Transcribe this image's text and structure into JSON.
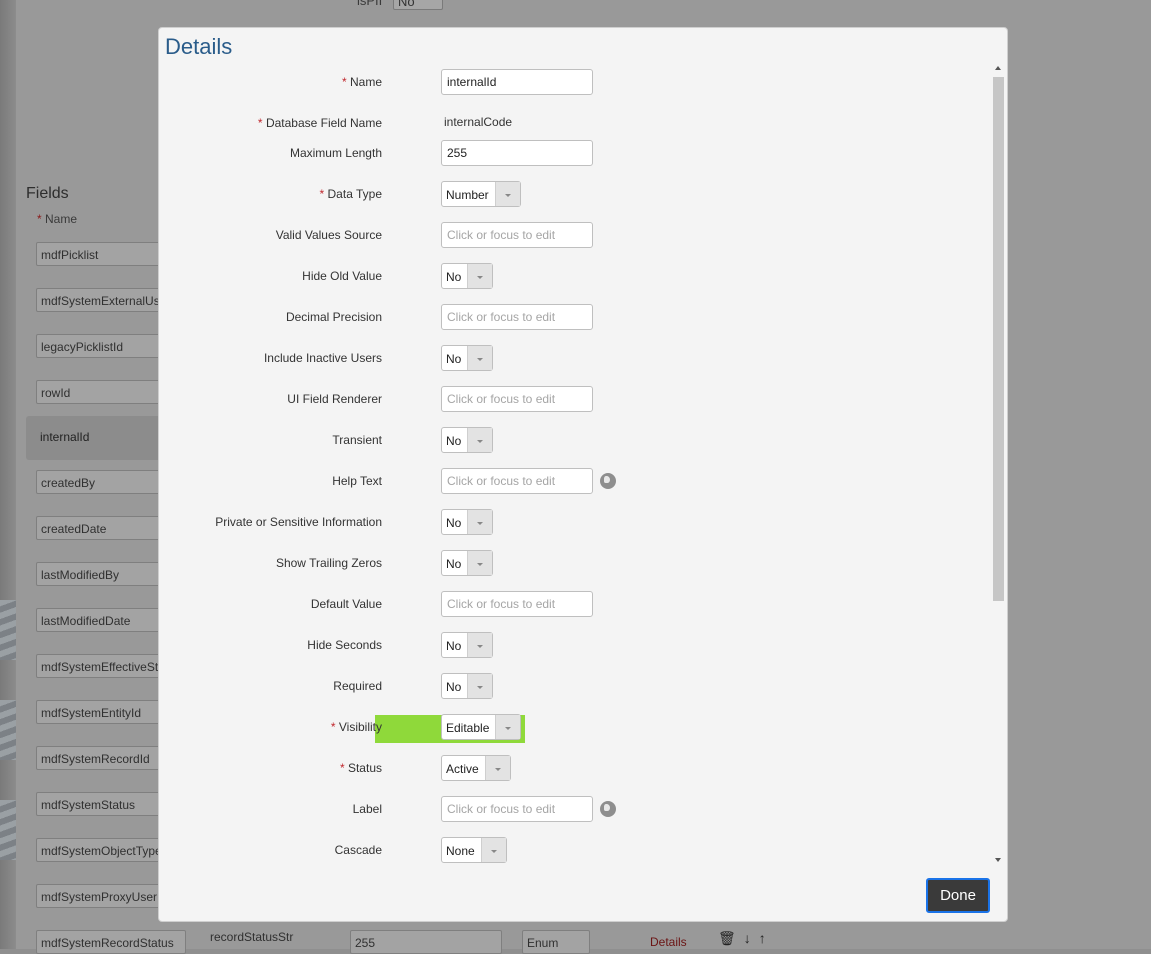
{
  "background": {
    "top_label": "isPII",
    "top_select": "No",
    "fields_title": "Fields",
    "name_header": "Name",
    "name_header_required": "*",
    "field_names": [
      "mdfPicklist",
      "mdfSystemExternalUs",
      "legacyPicklistId",
      "rowId",
      "internalId",
      "createdBy",
      "createdDate",
      "lastModifiedBy",
      "lastModifiedDate",
      "mdfSystemEffectiveSt",
      "mdfSystemEntityId",
      "mdfSystemRecordId",
      "mdfSystemStatus",
      "mdfSystemObjectType",
      "mdfSystemProxyUser",
      "mdfSystemRecordStatus"
    ],
    "bottom_row": {
      "db_field": "recordStatusStr",
      "length": "255",
      "type": "Enum",
      "details_link": "Details"
    }
  },
  "modal": {
    "title": "Details",
    "fields": [
      {
        "label": "Name",
        "required": true,
        "kind": "text",
        "value": "internalId"
      },
      {
        "label": "Database Field Name",
        "required": true,
        "kind": "static",
        "value": "internalCode"
      },
      {
        "label": "Maximum Length",
        "required": false,
        "kind": "text",
        "value": "255"
      },
      {
        "label": "Data Type",
        "required": true,
        "kind": "select",
        "value": "Number"
      },
      {
        "label": "Valid Values Source",
        "required": false,
        "kind": "placeholder",
        "value": "Click or focus to edit"
      },
      {
        "label": "Hide Old Value",
        "required": false,
        "kind": "select",
        "value": "No"
      },
      {
        "label": "Decimal Precision",
        "required": false,
        "kind": "placeholder",
        "value": "Click or focus to edit"
      },
      {
        "label": "Include Inactive Users",
        "required": false,
        "kind": "select",
        "value": "No"
      },
      {
        "label": "UI Field Renderer",
        "required": false,
        "kind": "placeholder",
        "value": "Click or focus to edit"
      },
      {
        "label": "Transient",
        "required": false,
        "kind": "select",
        "value": "No"
      },
      {
        "label": "Help Text",
        "required": false,
        "kind": "placeholder",
        "value": "Click or focus to edit",
        "globe": true
      },
      {
        "label": "Private or Sensitive Information",
        "required": false,
        "kind": "select",
        "value": "No"
      },
      {
        "label": "Show Trailing Zeros",
        "required": false,
        "kind": "select",
        "value": "No"
      },
      {
        "label": "Default Value",
        "required": false,
        "kind": "placeholder",
        "value": "Click or focus to edit"
      },
      {
        "label": "Hide Seconds",
        "required": false,
        "kind": "select",
        "value": "No"
      },
      {
        "label": "Required",
        "required": false,
        "kind": "select",
        "value": "No"
      },
      {
        "label": "Visibility",
        "required": true,
        "kind": "select",
        "value": "Editable",
        "highlight": true
      },
      {
        "label": "Status",
        "required": true,
        "kind": "select",
        "value": "Active"
      },
      {
        "label": "Label",
        "required": false,
        "kind": "placeholder",
        "value": "Click or focus to edit",
        "globe": true
      },
      {
        "label": "Cascade",
        "required": false,
        "kind": "select",
        "value": "None"
      }
    ],
    "done_label": "Done",
    "highlight_color": "#8fd93a"
  }
}
